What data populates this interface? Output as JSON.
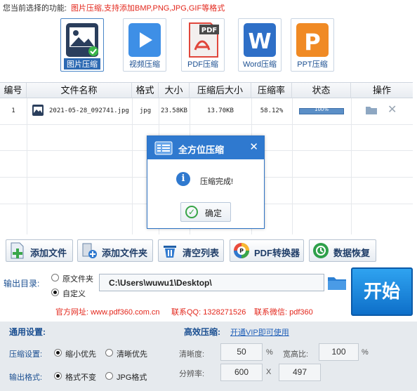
{
  "header": {
    "label": "您当前选择的功能:",
    "note": "图片压缩,支持添加BMP,PNG,JPG,GIF等格式"
  },
  "functions": [
    {
      "label": "图片压缩",
      "icon": "image-compress-icon"
    },
    {
      "label": "视频压缩",
      "icon": "video-compress-icon"
    },
    {
      "label": "PDF压缩",
      "icon": "pdf-compress-icon"
    },
    {
      "label": "Word压缩",
      "icon": "word-compress-icon"
    },
    {
      "label": "PPT压缩",
      "icon": "ppt-compress-icon"
    }
  ],
  "table": {
    "headers": [
      "编号",
      "文件名称",
      "格式",
      "大小",
      "压缩后大小",
      "压缩率",
      "状态",
      "操作"
    ],
    "rows": [
      {
        "index": "1",
        "filename": "2021-05-28_092741.jpg",
        "format": "jpg",
        "size": "23.58KB",
        "compressed": "13.70KB",
        "ratio": "58.12%",
        "status": "100%",
        "progress": 1.0
      }
    ]
  },
  "dialog": {
    "title": "全方位压缩",
    "message": "压缩完成!",
    "ok": "确定"
  },
  "toolbar": {
    "add_file": "添加文件",
    "add_folder": "添加文件夹",
    "clear_list": "清空列表",
    "pdf_converter": "PDF转换器",
    "data_recovery": "数据恢复"
  },
  "output": {
    "label": "输出目录:",
    "option_original": "原文件夹",
    "option_custom": "自定义",
    "path": "C:\\Users\\wuwu1\\Desktop\\",
    "start": "开始"
  },
  "contact": {
    "website": "官方网址: www.pdf360.com.cn",
    "qq": "联系QQ: 1328271526",
    "wechat": "联系微信: pdf360"
  },
  "settings": {
    "general_title": "通用设置:",
    "efficient_title": "高效压缩:",
    "vip_link": "开通VIP即可使用",
    "compress_label": "压缩设置:",
    "opt_small": "缩小优先",
    "opt_clear": "清晰优先",
    "format_label": "输出格式:",
    "opt_keep": "格式不变",
    "opt_jpg": "JPG格式",
    "clarity_label": "清晰度:",
    "clarity_value": "50",
    "percent": "%",
    "aspect_label": "宽高比:",
    "aspect_value": "100",
    "resolution_label": "分辨率:",
    "res_w": "600",
    "res_x": "X",
    "res_h": "497"
  },
  "colors": {
    "accent": "#2f79cf",
    "start": "#1683de",
    "note_red": "#e3271c"
  }
}
